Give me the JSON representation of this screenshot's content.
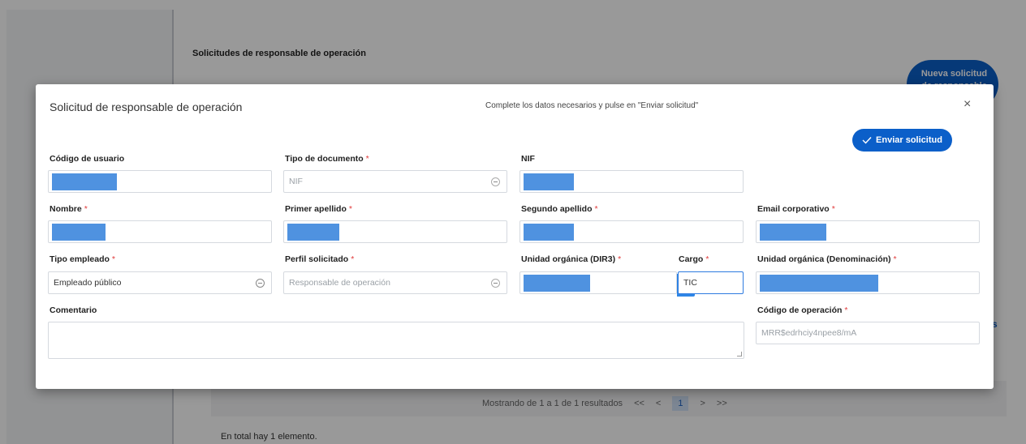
{
  "background": {
    "section_title": "Solicitudes de responsable de operación",
    "new_request_button": "Nueva solicitud de responsable",
    "pager": {
      "summary": "Mostrando de 1 a 1 de 1 resultados",
      "first": "<<",
      "prev": "<",
      "current": "1",
      "next": ">",
      "last": ">>"
    },
    "total": "En total hay 1 elemento.",
    "edge_letter": "s"
  },
  "modal": {
    "title": "Solicitud de responsable de operación",
    "subtitle": "Complete los datos necesarios y pulse en \"Enviar solicitud\"",
    "close": "×",
    "send_button": "Enviar solicitud",
    "required_mark": "*",
    "fields": {
      "codigo_usuario": {
        "label": "Código de usuario"
      },
      "tipo_documento": {
        "label": "Tipo de documento",
        "value": "NIF"
      },
      "nif": {
        "label": "NIF"
      },
      "nombre": {
        "label": "Nombre"
      },
      "primer_apellido": {
        "label": "Primer apellido"
      },
      "segundo_apellido": {
        "label": "Segundo apellido"
      },
      "email": {
        "label": "Email corporativo"
      },
      "tipo_empleado": {
        "label": "Tipo empleado",
        "value": "Empleado público"
      },
      "perfil": {
        "label": "Perfil solicitado",
        "value": "Responsable de operación"
      },
      "unidad_dir3": {
        "label": "Unidad orgánica (DIR3)"
      },
      "cargo": {
        "label": "Cargo",
        "value": "TIC"
      },
      "unidad_denominacion": {
        "label": "Unidad orgánica (Denominación)"
      },
      "comentario": {
        "label": "Comentario"
      },
      "codigo_operacion": {
        "label": "Código de operación",
        "value": "MRR$edrhciy4npee8/mA"
      }
    }
  },
  "colors": {
    "accent": "#0b5fc9",
    "redaction": "#4f92e0",
    "required": "#e03a3a"
  }
}
